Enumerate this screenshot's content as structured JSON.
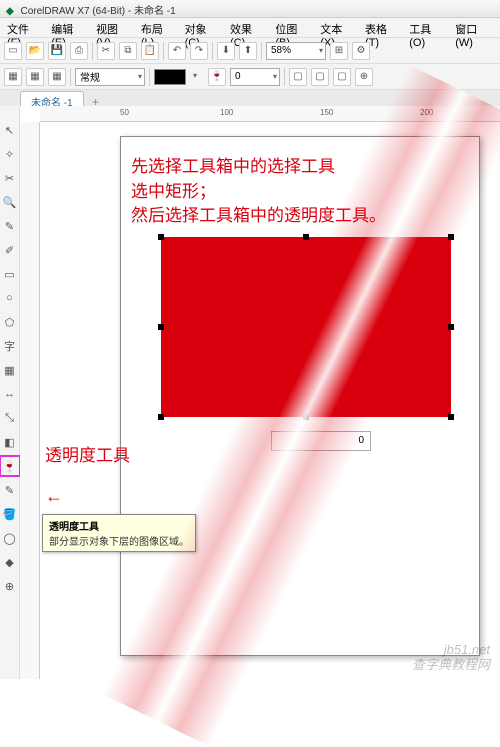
{
  "titlebar": {
    "app": "CorelDRAW X7 (64-Bit)",
    "doc": "未命名 -1"
  },
  "menu": {
    "file": "文件(F)",
    "edit": "编辑(E)",
    "view": "视图(V)",
    "layout": "布局(L)",
    "object": "对象(C)",
    "effects": "效果(C)",
    "bitmap": "位图(B)",
    "text": "文本(X)",
    "table": "表格(T)",
    "tools": "工具(O)",
    "window": "窗口(W)"
  },
  "toolbar1": {
    "zoom": "58%"
  },
  "toolbar2": {
    "style": "常规"
  },
  "tab": {
    "name": "未命名 -1"
  },
  "ruler": {
    "m50": "50",
    "m100": "100",
    "m150": "150",
    "m200": "200"
  },
  "annotation": {
    "line1": "先选择工具箱中的选择工具",
    "line2": "选中矩形；",
    "line3": "然后选择工具箱中的透明度工具。"
  },
  "label": {
    "transparency": "透明度工具"
  },
  "tooltip": {
    "title": "透明度工具",
    "desc": "部分显示对象下层的图像区域。"
  },
  "input": {
    "value": "0"
  },
  "watermark": {
    "line1": "jb51.net",
    "line2": "查字典教程网"
  }
}
